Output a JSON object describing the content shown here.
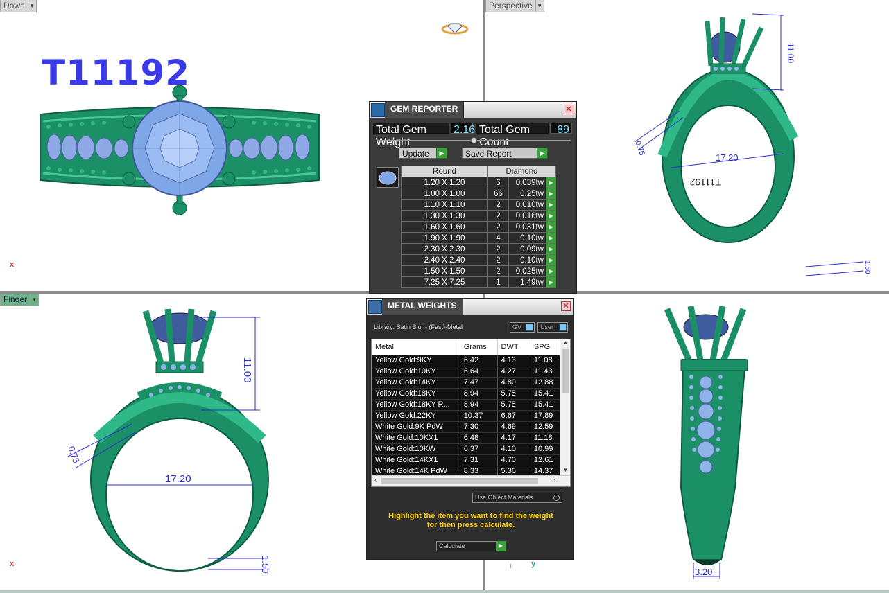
{
  "viewports": {
    "top_left_label": "Down",
    "top_right_label": "Perspective",
    "bottom_left_label": "Finger"
  },
  "model": {
    "title": "T11192"
  },
  "axes": {
    "x": "x",
    "y": "y"
  },
  "dimensions": {
    "height": "11.00",
    "inner_diameter": "17.20",
    "prong": "0.75",
    "band": "1.50",
    "shank_width": "3.20"
  },
  "gem_reporter": {
    "title": "GEM REPORTER",
    "total_weight_label": "Total Gem Weight",
    "total_weight_value": "2.16",
    "total_count_label": "Total Gem Count",
    "total_count_value": "89",
    "update_label": "Update",
    "save_label": "Save Report",
    "col_shape": "Round",
    "col_material": "Diamond",
    "rows": [
      {
        "size": "1.20 X 1.20",
        "count": "6",
        "tw": "0.039tw"
      },
      {
        "size": "1.00 X 1.00",
        "count": "66",
        "tw": "0.25tw"
      },
      {
        "size": "1.10 X 1.10",
        "count": "2",
        "tw": "0.010tw"
      },
      {
        "size": "1.30 X 1.30",
        "count": "2",
        "tw": "0.016tw"
      },
      {
        "size": "1.60 X 1.60",
        "count": "2",
        "tw": "0.031tw"
      },
      {
        "size": "1.90 X 1.90",
        "count": "4",
        "tw": "0.10tw"
      },
      {
        "size": "2.30 X 2.30",
        "count": "2",
        "tw": "0.09tw"
      },
      {
        "size": "2.40 X 2.40",
        "count": "2",
        "tw": "0.10tw"
      },
      {
        "size": "1.50 X 1.50",
        "count": "2",
        "tw": "0.025tw"
      },
      {
        "size": "7.25 X 7.25",
        "count": "1",
        "tw": "1.49tw"
      }
    ]
  },
  "metal_weights": {
    "title": "METAL WEIGHTS",
    "library": "Library: Satin Blur - (Fast)-Metal",
    "toggle_gv": "GV",
    "toggle_user": "User",
    "headers": [
      "Metal",
      "Grams",
      "DWT",
      "SPG"
    ],
    "rows": [
      [
        "Yellow Gold:9KY",
        "6.42",
        "4.13",
        "11.08"
      ],
      [
        "Yellow Gold:10KY",
        "6.64",
        "4.27",
        "11.43"
      ],
      [
        "Yellow Gold:14KY",
        "7.47",
        "4.80",
        "12.88"
      ],
      [
        "Yellow Gold:18KY",
        "8.94",
        "5.75",
        "15.41"
      ],
      [
        "Yellow Gold:18KY R...",
        "8.94",
        "5.75",
        "15.41"
      ],
      [
        "Yellow Gold:22KY",
        "10.37",
        "6.67",
        "17.89"
      ],
      [
        "White Gold:9K PdW",
        "7.30",
        "4.69",
        "12.59"
      ],
      [
        "White Gold:10KX1",
        "6.48",
        "4.17",
        "11.18"
      ],
      [
        "White Gold:10KW",
        "6.37",
        "4.10",
        "10.99"
      ],
      [
        "White Gold:14KX1",
        "7.31",
        "4.70",
        "12.61"
      ],
      [
        "White Gold:14K PdW",
        "8.33",
        "5.36",
        "14.37"
      ]
    ],
    "use_object_materials": "Use Object Materials",
    "hint_line1": "Highlight the item you want to find the weight",
    "hint_line2": "for then press calculate.",
    "calculate_label": "Calculate"
  },
  "colors": {
    "ring_green": "#1fa676",
    "gem_blue": "#7fa6e6",
    "dim_blue": "#2b2bd6",
    "title_blue": "#3a3ae8"
  }
}
